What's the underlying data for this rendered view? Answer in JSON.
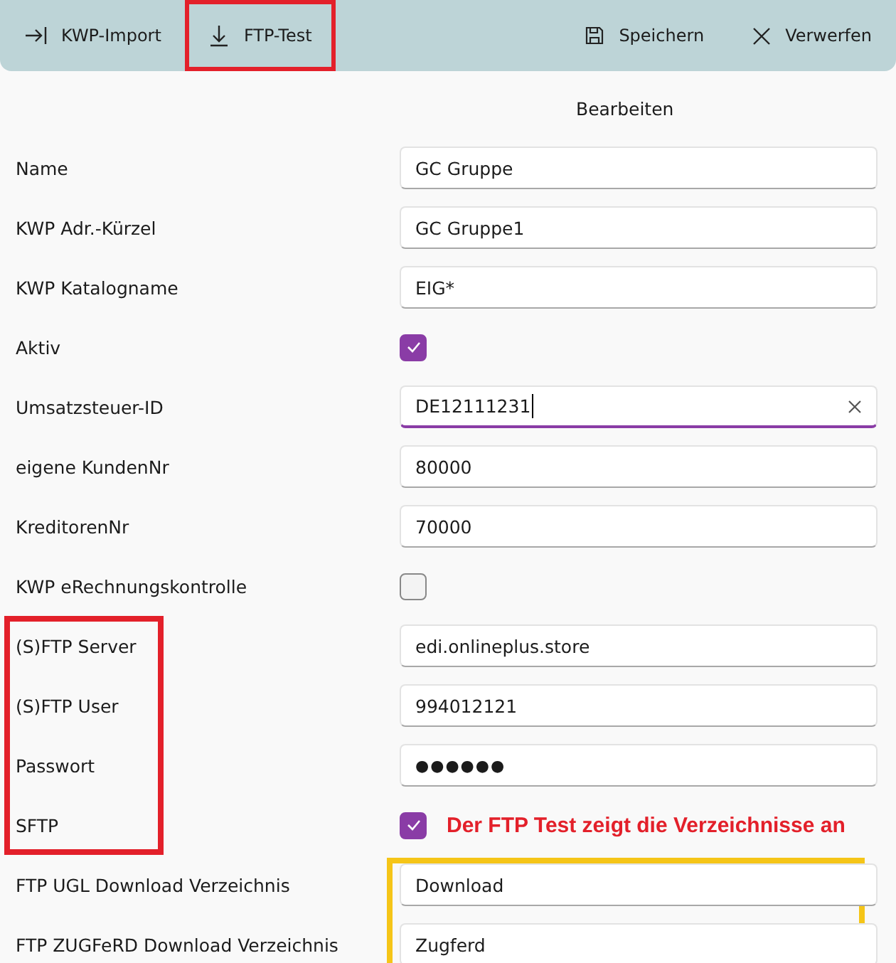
{
  "toolbar": {
    "items": [
      {
        "kind": "import",
        "label": "KWP-Import",
        "marked": false
      },
      {
        "kind": "download",
        "label": "FTP-Test",
        "marked": true
      }
    ],
    "actions": [
      {
        "kind": "save",
        "label": "Speichern"
      },
      {
        "kind": "discard",
        "label": "Verwerfen"
      }
    ]
  },
  "section_title": "Bearbeiten",
  "rows": [
    {
      "label": "Name",
      "kind": "text",
      "value": "GC Gruppe",
      "focused": false
    },
    {
      "label": "KWP Adr.-Kürzel",
      "kind": "text",
      "value": "GC Gruppe1",
      "focused": false
    },
    {
      "label": "KWP Katalogname",
      "kind": "text",
      "value": "EIG*",
      "focused": false
    },
    {
      "label": "Aktiv",
      "kind": "checkbox",
      "checked": true
    },
    {
      "label": "Umsatzsteuer-ID",
      "kind": "text",
      "value": "DE12111231",
      "focused": true
    },
    {
      "label": "eigene KundenNr",
      "kind": "text",
      "value": "80000",
      "focused": false
    },
    {
      "label": "KreditorenNr",
      "kind": "text",
      "value": "70000",
      "focused": false
    },
    {
      "label": "KWP eRechnungskontrolle",
      "kind": "checkbox",
      "checked": false
    },
    {
      "label": "(S)FTP Server",
      "kind": "text",
      "value": "edi.onlineplus.store",
      "focused": false,
      "label_framed": true
    },
    {
      "label": "(S)FTP User",
      "kind": "text",
      "value": "994012121",
      "focused": false,
      "label_framed": true
    },
    {
      "label": "Passwort",
      "kind": "password",
      "value": "●●●●●●",
      "label_framed": true
    },
    {
      "label": "SFTP",
      "kind": "checkbox",
      "checked": true,
      "note": "Der FTP Test zeigt die Verzeichnisse an",
      "label_framed": true
    },
    {
      "label": "FTP UGL Download Verzeichnis",
      "kind": "text",
      "value": "Download",
      "focused": false,
      "value_framed": true
    },
    {
      "label": "FTP ZUGFeRD Download Verzeichnis",
      "kind": "text",
      "value": "Zugferd",
      "focused": false,
      "value_framed": true
    }
  ]
}
